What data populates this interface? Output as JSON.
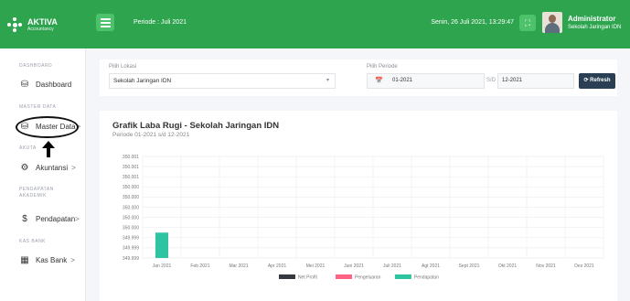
{
  "brand": {
    "name": "AKTIVA",
    "sub": "Accountancy"
  },
  "header": {
    "periode": "Periode : Juli 2021",
    "datetime": "Senin, 26 Juli 2021, 13:29:47",
    "admin_name": "Administrator",
    "admin_sub": "Sekolah Jaringan IDN"
  },
  "sidebar": {
    "sections": [
      {
        "label": "DASHBOARD"
      },
      {
        "label": "MASTER DATA"
      },
      {
        "label": "AKUTA"
      },
      {
        "label": "PENDAPATAN AKADEMIK"
      },
      {
        "label": "KAS BANK"
      }
    ],
    "items": [
      {
        "label": "Dashboard",
        "icon": "database-icon"
      },
      {
        "label": "Master Data",
        "icon": "database-icon",
        "chevron": ">"
      },
      {
        "label": "Akuntansi",
        "icon": "cogs-icon",
        "chevron": ">"
      },
      {
        "label": "Pendapatan",
        "icon": "dollar-icon",
        "chevron": ">"
      },
      {
        "label": "Kas Bank",
        "icon": "table-icon",
        "chevron": ">"
      }
    ]
  },
  "filter": {
    "lokasi_label": "Pilih Lokasi",
    "lokasi_value": "Sekolah Jaringan IDN",
    "periode_label": "Pilih Periode",
    "periode_start": "01-2021",
    "sd_label": "S/D",
    "periode_end": "12-2021",
    "refresh_label": "Refresh"
  },
  "colors": {
    "primary": "#2ea44f",
    "net_profit": "#343a40",
    "pengeluaran": "#ff6384",
    "pendapatan": "#2ec4a0"
  },
  "chart_data": {
    "type": "bar",
    "title": "Grafik Laba Rugi - Sekolah Jaringan IDN",
    "subtitle": "Periode 01-2021 s/d 12-2021",
    "categories": [
      "Jan 2021",
      "Feb 2021",
      "Mar 2021",
      "Apr 2021",
      "Mei 2021",
      "Juni 2021",
      "Juli 2021",
      "Agt 2021",
      "Sept 2021",
      "Okt 2021",
      "Nov 2021",
      "Des 2021"
    ],
    "y_ticks": [
      "349.999",
      "349.999",
      "349.999",
      "350.000",
      "350.000",
      "350.000",
      "350.000",
      "350.000",
      "350.001",
      "350.001",
      "350.001"
    ],
    "ylim": [
      349.9995,
      350.0015
    ],
    "series": [
      {
        "name": "Net Profit",
        "values": [
          0,
          0,
          0,
          0,
          0,
          0,
          0,
          0,
          0,
          0,
          0,
          0
        ]
      },
      {
        "name": "Pengeluaran",
        "values": [
          0,
          0,
          0,
          0,
          0,
          0,
          0,
          0,
          0,
          0,
          0,
          0
        ]
      },
      {
        "name": "Pendapatan",
        "values": [
          350000,
          0,
          0,
          0,
          0,
          0,
          0,
          0,
          0,
          0,
          0,
          0
        ]
      }
    ],
    "legend": "bottom",
    "grid": true
  }
}
